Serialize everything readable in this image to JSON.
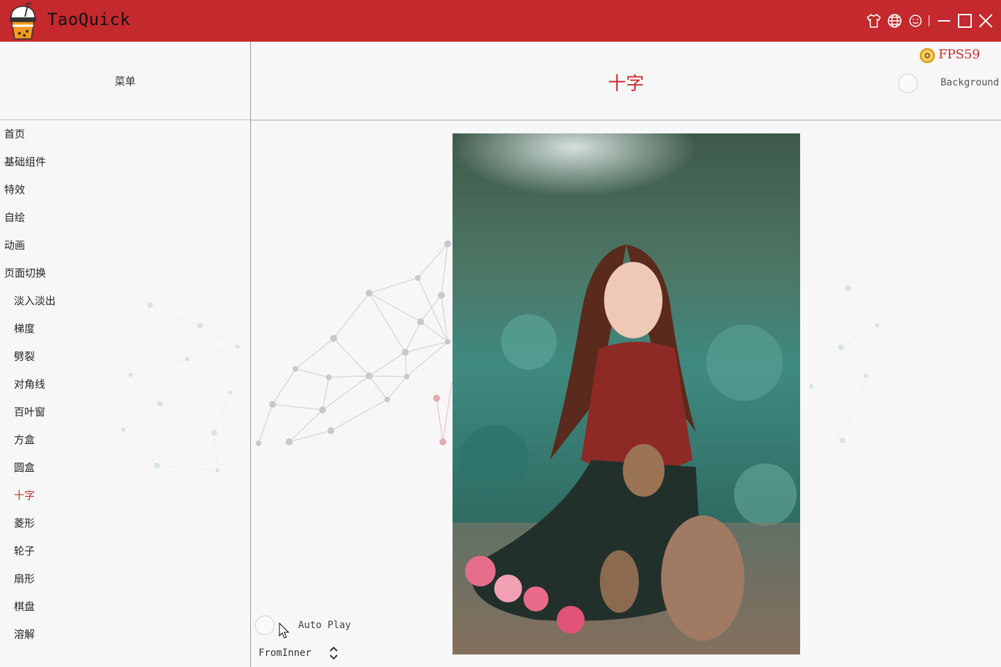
{
  "app": {
    "title": "TaoQuick"
  },
  "titlebar_icons": [
    "shirt-icon",
    "globe-icon",
    "smile-icon",
    "minimize-icon",
    "maximize-icon",
    "close-icon"
  ],
  "menu": {
    "title": "菜单",
    "items": [
      {
        "label": "首页",
        "level": 0,
        "active": false
      },
      {
        "label": "基础组件",
        "level": 0,
        "active": false
      },
      {
        "label": "特效",
        "level": 0,
        "active": false
      },
      {
        "label": "自绘",
        "level": 0,
        "active": false
      },
      {
        "label": "动画",
        "level": 0,
        "active": false
      },
      {
        "label": "页面切换",
        "level": 0,
        "active": false
      },
      {
        "label": "淡入淡出",
        "level": 1,
        "active": false
      },
      {
        "label": "梯度",
        "level": 1,
        "active": false
      },
      {
        "label": "劈裂",
        "level": 1,
        "active": false
      },
      {
        "label": "对角线",
        "level": 1,
        "active": false
      },
      {
        "label": "百叶窗",
        "level": 1,
        "active": false
      },
      {
        "label": "方盒",
        "level": 1,
        "active": false
      },
      {
        "label": "圆盒",
        "level": 1,
        "active": false
      },
      {
        "label": "十字",
        "level": 1,
        "active": true
      },
      {
        "label": "菱形",
        "level": 1,
        "active": false
      },
      {
        "label": "轮子",
        "level": 1,
        "active": false
      },
      {
        "label": "扇形",
        "level": 1,
        "active": false
      },
      {
        "label": "棋盘",
        "level": 1,
        "active": false
      },
      {
        "label": "溶解",
        "level": 1,
        "active": false
      }
    ]
  },
  "main": {
    "title": "十字",
    "fps": "FPS59",
    "background_label": "Background",
    "autoplay_label": "Auto Play",
    "mode_value": "FromInner"
  },
  "colors": {
    "accent": "#c3292d",
    "background": "#f7f7f7",
    "divider": "#bdbdbd"
  }
}
